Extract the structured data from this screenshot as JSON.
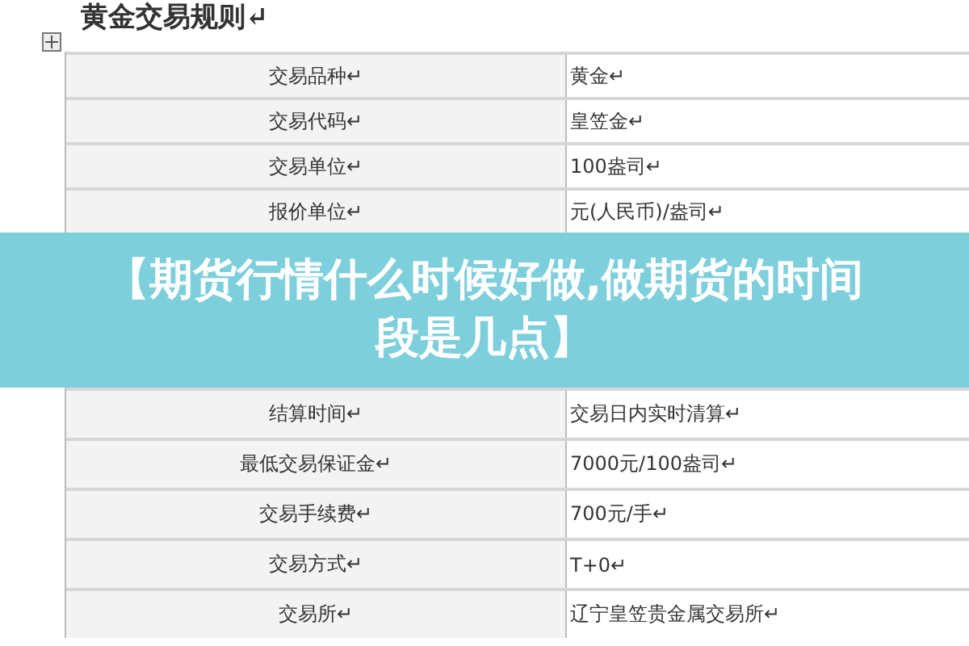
{
  "document": {
    "title": "黄金交易规则↵"
  },
  "table": {
    "rows": [
      {
        "label": "交易品种↵",
        "value": "黄金↵"
      },
      {
        "label": "交易代码↵",
        "value": "皇笠金↵"
      },
      {
        "label": "交易单位↵",
        "value": "100盎司↵"
      },
      {
        "label": "报价单位↵",
        "value": "元(人民币)/盎司↵"
      }
    ]
  },
  "banner": {
    "text": "【期货行情什么时候好做,做期货的时间段是几点】"
  },
  "table_continued": {
    "rows": [
      {
        "label": "结算时间↵",
        "value": "交易日内实时清算↵"
      },
      {
        "label": "最低交易保证金↵",
        "value": "7000元/100盎司↵"
      },
      {
        "label": "交易手续费↵",
        "value": "700元/手↵"
      },
      {
        "label": "交易方式↵",
        "value": "T+0↵"
      },
      {
        "label": "交易所↵",
        "value": "辽宁皇笠贵金属交易所↵"
      }
    ]
  }
}
